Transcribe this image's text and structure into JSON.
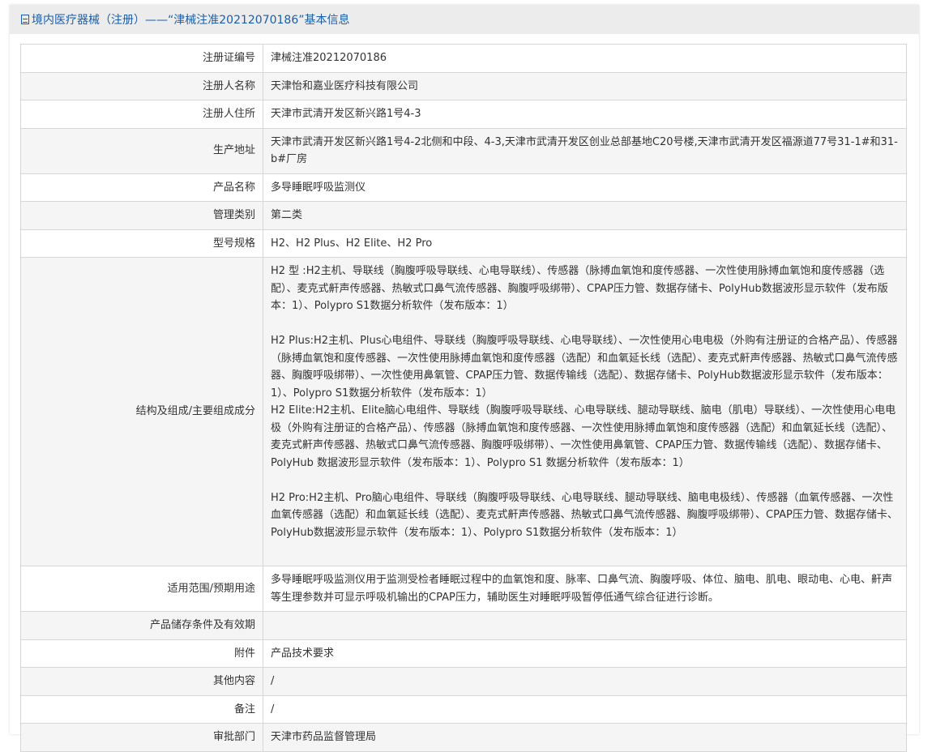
{
  "header": {
    "title": "境内医疗器械（注册）——“津械注准20212070186”基本信息"
  },
  "rows": [
    {
      "label": "注册证编号",
      "value": "津械注准20212070186"
    },
    {
      "label": "注册人名称",
      "value": "天津怡和嘉业医疗科技有限公司"
    },
    {
      "label": "注册人住所",
      "value": "天津市武清开发区新兴路1号4-3"
    },
    {
      "label": "生产地址",
      "value": "天津市武清开发区新兴路1号4-2北侧和中段、4-3,天津市武清开发区创业总部基地C20号楼,天津市武清开发区福源道77号31-1#和31-b#厂房"
    },
    {
      "label": "产品名称",
      "value": "多导睡眠呼吸监测仪"
    },
    {
      "label": "管理类别",
      "value": "第二类"
    },
    {
      "label": "型号规格",
      "value": "H2、H2 Plus、H2 Elite、H2 Pro"
    },
    {
      "label": "结构及组成/主要组成成分",
      "value": "H2 型 :H2主机、导联线（胸腹呼吸导联线、心电导联线）、传感器（脉搏血氧饱和度传感器、一次性使用脉搏血氧饱和度传感器（选配）、麦克式鼾声传感器、热敏式口鼻气流传感器、胸腹呼吸绑带）、CPAP压力管、数据存储卡、PolyHub数据波形显示软件（发布版本：1）、Polypro S1数据分析软件（发布版本：1）\n\nH2 Plus:H2主机、Plus心电组件、导联线（胸腹呼吸导联线、心电导联线）、一次性使用心电电极（外购有注册证的合格产品）、传感器（脉搏血氧饱和度传感器、一次性使用脉搏血氧饱和度传感器（选配）和血氧延长线（选配）、麦克式鼾声传感器、热敏式口鼻气流传感器、胸腹呼吸绑带）、一次性使用鼻氧管、CPAP压力管、数据传输线（选配）、数据存储卡、PolyHub数据波形显示软件（发布版本：1）、Polypro S1数据分析软件（发布版本：1）\nH2 Elite:H2主机、Elite脑心电组件、导联线（胸腹呼吸导联线、心电导联线、腿动导联线、脑电（肌电）导联线）、一次性使用心电电极（外购有注册证的合格产品）、传感器（脉搏血氧饱和度传感器、一次性使用脉搏血氧饱和度传感器（选配）和血氧延长线（选配）、麦克式鼾声传感器、热敏式口鼻气流传感器、胸腹呼吸绑带）、一次性使用鼻氧管、CPAP压力管、数据传输线（选配）、数据存储卡、PolyHub 数据波形显示软件（发布版本：1）、Polypro S1 数据分析软件（发布版本：1）\n\nH2 Pro:H2主机、Pro脑心电组件、导联线（胸腹呼吸导联线、心电导联线、腿动导联线、脑电电极线）、传感器（血氧传感器、一次性血氧传感器（选配）和血氧延长线（选配）、麦克式鼾声传感器、热敏式口鼻气流传感器、胸腹呼吸绑带）、CPAP压力管、数据存储卡、PolyHub数据波形显示软件（发布版本：1）、Polypro S1数据分析软件（发布版本：1）"
    },
    {
      "label": "适用范围/预期用途",
      "value": "多导睡眠呼吸监测仪用于监测受检者睡眠过程中的血氧饱和度、脉率、口鼻气流、胸腹呼吸、体位、脑电、肌电、眼动电、心电、鼾声等生理参数并可显示呼吸机输出的CPAP压力，辅助医生对睡眠呼吸暂停低通气综合征进行诊断。"
    },
    {
      "label": "产品储存条件及有效期",
      "value": ""
    },
    {
      "label": "附件",
      "value": "产品技术要求"
    },
    {
      "label": "其他内容",
      "value": "/"
    },
    {
      "label": "备注",
      "value": "/"
    },
    {
      "label": "审批部门",
      "value": "天津市药品监督管理局"
    }
  ]
}
